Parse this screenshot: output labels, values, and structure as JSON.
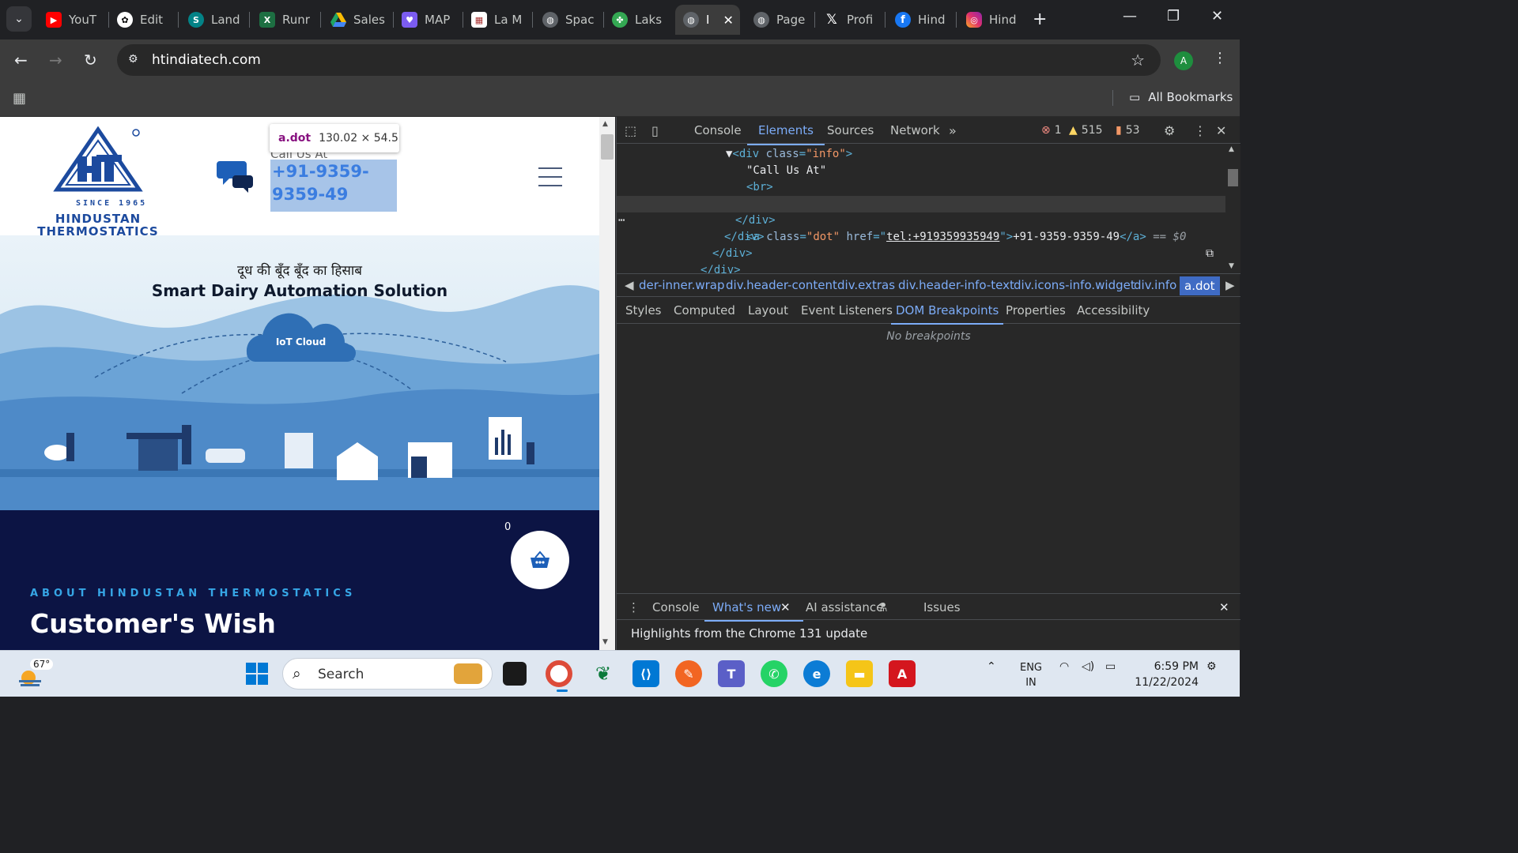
{
  "browser": {
    "tabs": [
      {
        "label": "YouT",
        "icon": "youtube-icon",
        "color": "#ff0000"
      },
      {
        "label": "Edit",
        "icon": "openai-icon",
        "color": "#ffffff"
      },
      {
        "label": "Land",
        "icon": "sharepoint-icon",
        "color": "#038387"
      },
      {
        "label": "Runr",
        "icon": "excel-icon",
        "color": "#1d6f42"
      },
      {
        "label": "Sales",
        "icon": "google-drive-icon",
        "color": "#fbbc04"
      },
      {
        "label": "MAP",
        "icon": "heart-icon",
        "color": "#7b5cf0"
      },
      {
        "label": "La M",
        "icon": "document-icon",
        "color": "#ffffff"
      },
      {
        "label": "Spac",
        "icon": "globe-icon",
        "color": "#9aa0a6"
      },
      {
        "label": "Laks",
        "icon": "leaf-icon",
        "color": "#34a853"
      },
      {
        "label": "I",
        "icon": "globe-icon",
        "color": "#9aa0a6",
        "active": true
      },
      {
        "label": "Page",
        "icon": "globe-icon",
        "color": "#9aa0a6"
      },
      {
        "label": "Profi",
        "icon": "x-logo-icon",
        "color": "#000000"
      },
      {
        "label": "Hind",
        "icon": "facebook-icon",
        "color": "#1877f2"
      },
      {
        "label": "Hind",
        "icon": "instagram-icon",
        "color": "#e1306c"
      }
    ],
    "url": "htindiatech.com",
    "avatar_letter": "A",
    "all_bookmarks": "All Bookmarks"
  },
  "website": {
    "brand_since": "SINCE 1965",
    "brand_line1": "HINDUSTAN",
    "brand_line2": "THERMOSTATICS",
    "call_us": "Call Us At",
    "phone": "+91-9359-9359-49",
    "tooltip_tag": "a.dot",
    "tooltip_size": "130.02 × 54.5",
    "banner_hindi": "दूध की बूँद बूँद का हिसाब",
    "banner_headline": "Smart Dairy Automation Solution",
    "cloud_label": "IoT Cloud",
    "cart_count": "0",
    "about_kicker": "ABOUT HINDUSTAN THERMOSTATICS",
    "about_title": "Customer's Wish"
  },
  "devtools": {
    "tabs": [
      "Console",
      "Elements",
      "Sources",
      "Network"
    ],
    "active_tab": "Elements",
    "errors": "1",
    "warnings": "515",
    "issues": "53",
    "code": {
      "line1_tag": "<div ",
      "line1_attr": "class",
      "line1_val": "\"info\"",
      "line2": "\"Call Us At\"",
      "line3": "<br>",
      "line4_open": "<a ",
      "line4_attr1": "class",
      "line4_val1": "\"dot\"",
      "line4_attr2": "href",
      "line4_link": "tel:+919359935949",
      "line4_text": "+91-9359-9359-49",
      "line4_close": "</a>",
      "line4_eq": " == $0",
      "line5": "</div>",
      "line6": "</div>",
      "line7": "</div>",
      "line8": "</div>"
    },
    "breadcrumbs": [
      "der-inner.wrap",
      "div.header-content",
      "div.extras",
      "div.header-info-text",
      "div.icons-info.widget",
      "div.info",
      "a.dot"
    ],
    "subtabs": [
      "Styles",
      "Computed",
      "Layout",
      "Event Listeners",
      "DOM Breakpoints",
      "Properties",
      "Accessibility"
    ],
    "active_subtab": "DOM Breakpoints",
    "no_breakpoints": "No breakpoints",
    "drawer_tabs": [
      "Console",
      "What's new",
      "AI assistance",
      "Issues"
    ],
    "drawer_active": "What's new",
    "highlights": "Highlights from the Chrome 131 update"
  },
  "taskbar": {
    "temperature": "67°",
    "search": "Search",
    "language_line1": "ENG",
    "language_line2": "IN",
    "time": "6:59 PM",
    "date": "11/22/2024"
  }
}
